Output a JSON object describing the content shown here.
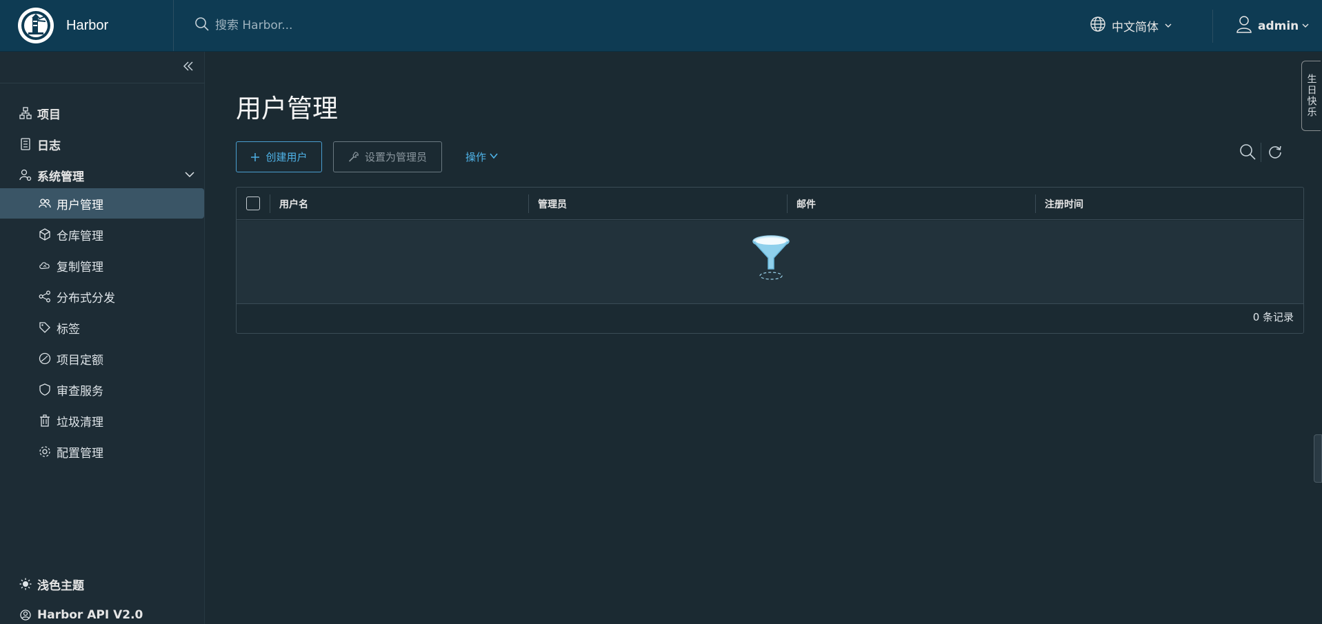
{
  "header": {
    "brand": "Harbor",
    "search_placeholder": "搜索 Harbor...",
    "language": "中文简体",
    "user": "admin"
  },
  "sidebar": {
    "items": [
      {
        "label": "项目",
        "icon": "projects-icon"
      },
      {
        "label": "日志",
        "icon": "logs-icon"
      },
      {
        "label": "系统管理",
        "icon": "system-admin-icon"
      }
    ],
    "sub_items": [
      {
        "label": "用户管理",
        "icon": "users-icon"
      },
      {
        "label": "仓库管理",
        "icon": "box-icon"
      },
      {
        "label": "复制管理",
        "icon": "cloud-icon"
      },
      {
        "label": "分布式分发",
        "icon": "share-icon"
      },
      {
        "label": "标签",
        "icon": "tag-icon"
      },
      {
        "label": "项目定额",
        "icon": "quota-icon"
      },
      {
        "label": "审查服务",
        "icon": "shield-icon"
      },
      {
        "label": "垃圾清理",
        "icon": "trash-icon"
      },
      {
        "label": "配置管理",
        "icon": "gear-icon"
      }
    ],
    "bottom": {
      "theme": "浅色主题",
      "api": "Harbor API V2.0"
    }
  },
  "main": {
    "title": "用户管理",
    "create_user": "创建用户",
    "set_admin": "设置为管理员",
    "actions": "操作",
    "columns": [
      "用户名",
      "管理员",
      "邮件",
      "注册时间"
    ],
    "footer": "0 条记录"
  },
  "side_tab": "生日快乐",
  "colors": {
    "header_bg": "#0e3b53",
    "sidebar_bg": "#1d2c35",
    "main_bg": "#1b2a32",
    "accent": "#4fb3e8",
    "active_item": "#3a5566"
  }
}
